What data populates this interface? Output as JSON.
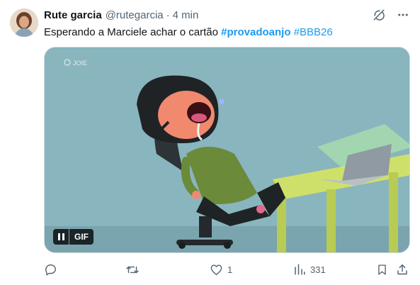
{
  "author": {
    "name": "Rute garcia",
    "handle": "@rutegarcia",
    "separator": "·",
    "time": "4 min"
  },
  "tweet": {
    "text": "Esperando a Marciele achar o cartão",
    "hashtags": [
      "#provadoanjo",
      "#BBB26"
    ]
  },
  "media": {
    "watermark": "JOIE",
    "gif_label": "GIF"
  },
  "actions": {
    "reply_count": "",
    "retweet_count": "",
    "like_count": "1",
    "views_count": "331"
  },
  "icons": {
    "grok": "grok-icon",
    "more": "more-icon",
    "reply": "reply-icon",
    "retweet": "retweet-icon",
    "like": "heart-icon",
    "views": "views-icon",
    "bookmark": "bookmark-icon",
    "share": "share-icon"
  },
  "colors": {
    "accent": "#1d9bf0",
    "secondary_text": "#536471",
    "primary_text": "#0f1419"
  }
}
